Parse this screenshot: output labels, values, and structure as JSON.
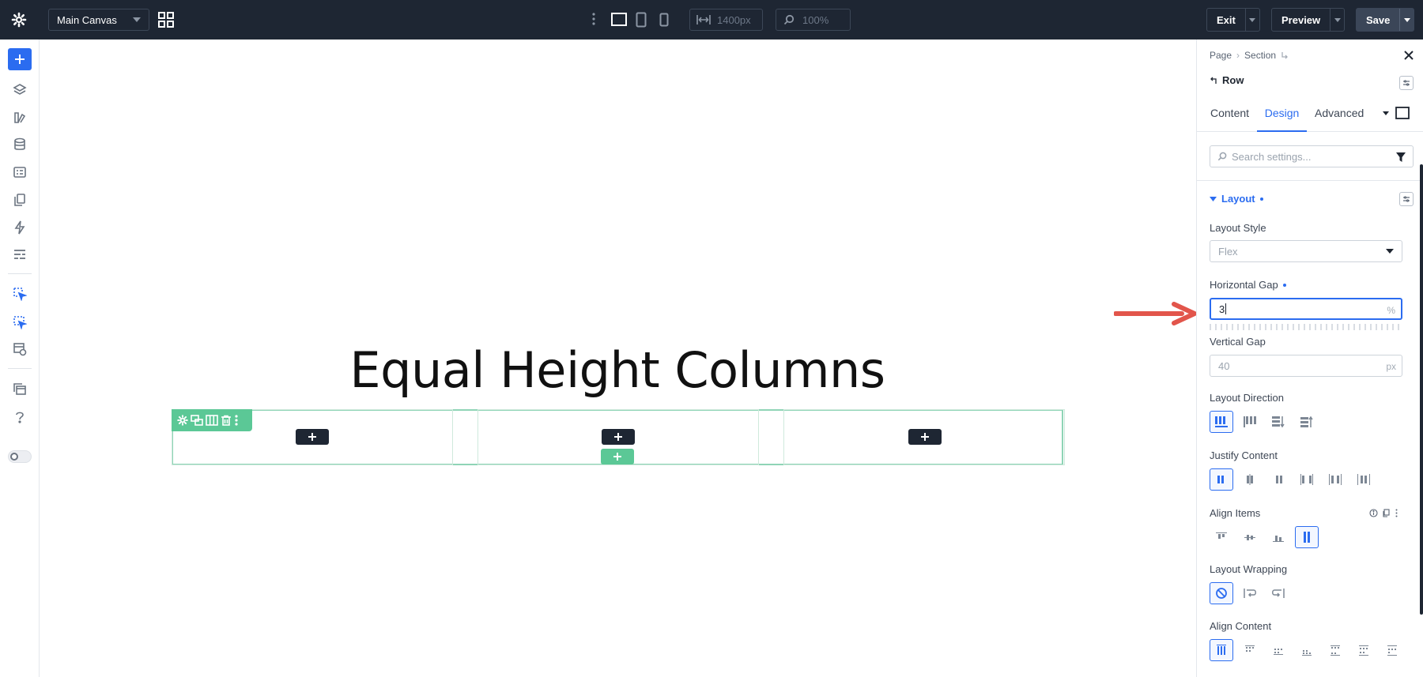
{
  "topbar": {
    "canvas_select": "Main Canvas",
    "width_value": "1400px",
    "zoom_value": "100%",
    "exit_label": "Exit",
    "preview_label": "Preview",
    "save_label": "Save"
  },
  "canvas": {
    "headline": "Equal Height Columns"
  },
  "panel": {
    "breadcrumb": [
      "Page",
      "Section"
    ],
    "element_title": "Row",
    "tabs": [
      {
        "label": "Content",
        "active": false
      },
      {
        "label": "Design",
        "active": true
      },
      {
        "label": "Advanced",
        "active": false
      }
    ],
    "search_placeholder": "Search settings...",
    "layout": {
      "section_title": "Layout",
      "layout_style_label": "Layout Style",
      "layout_style_value": "Flex",
      "horizontal_gap_label": "Horizontal Gap",
      "horizontal_gap_value": "3",
      "horizontal_gap_unit": "%",
      "vertical_gap_label": "Vertical Gap",
      "vertical_gap_value": "40",
      "vertical_gap_unit": "px",
      "layout_direction_label": "Layout Direction",
      "justify_content_label": "Justify Content",
      "align_items_label": "Align Items",
      "layout_wrapping_label": "Layout Wrapping",
      "align_content_label": "Align Content"
    }
  },
  "colors": {
    "accent": "#2b6cf0",
    "topbar_bg": "#1e2633",
    "row_outline": "#5bc896",
    "arrow": "#e2554b"
  }
}
